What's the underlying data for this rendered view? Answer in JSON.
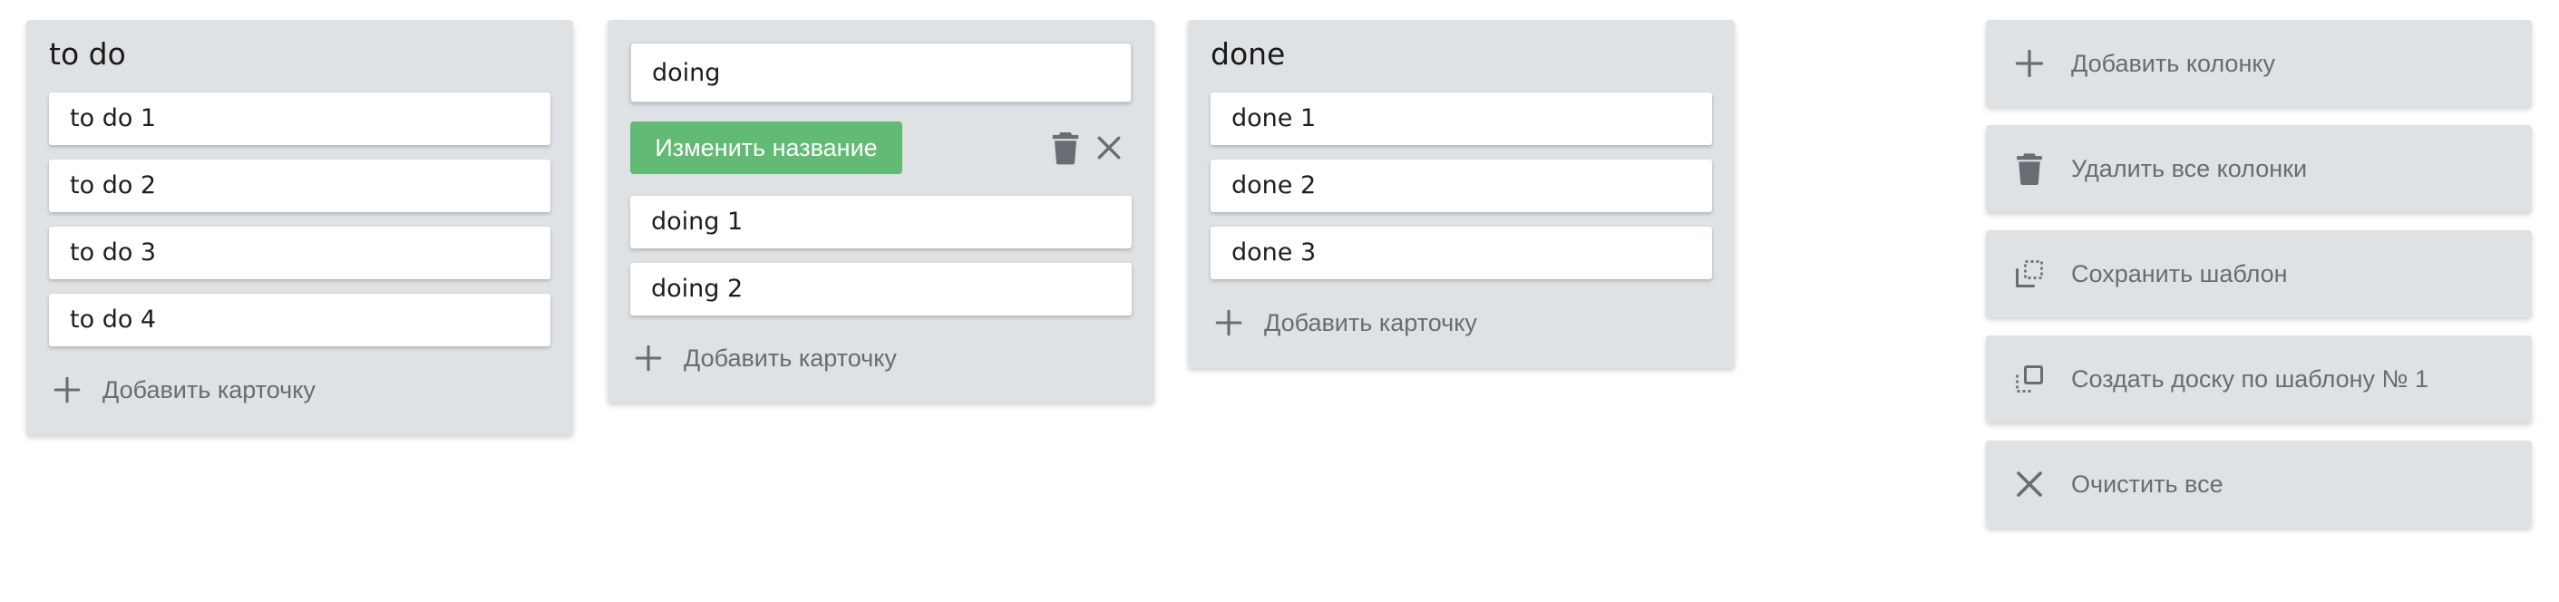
{
  "columns": [
    {
      "title": "to do",
      "cards": [
        "to do 1",
        "to do 2",
        "to do 3",
        "to do 4"
      ],
      "add_card_label": "Добавить карточку"
    },
    {
      "title_input_value": "doing",
      "rename_label": "Изменить название",
      "cards": [
        "doing 1",
        "doing 2"
      ],
      "add_card_label": "Добавить карточку"
    },
    {
      "title": "done",
      "cards": [
        "done 1",
        "done 2",
        "done 3"
      ],
      "add_card_label": "Добавить карточку"
    }
  ],
  "sidebar": {
    "actions": [
      {
        "label": "Добавить колонку",
        "icon": "plus-icon"
      },
      {
        "label": "Удалить все колонки",
        "icon": "trash-icon"
      },
      {
        "label": "Сохранить шаблон",
        "icon": "save-template-icon"
      },
      {
        "label": "Создать доску по шаблону № 1",
        "icon": "create-from-template-icon"
      },
      {
        "label": "Очистить все",
        "icon": "close-icon"
      }
    ]
  },
  "colors": {
    "column_bg": "#dfe2e5",
    "accent_green": "#61bb74",
    "muted_text": "#676d73",
    "icon_gray": "#676d73"
  }
}
